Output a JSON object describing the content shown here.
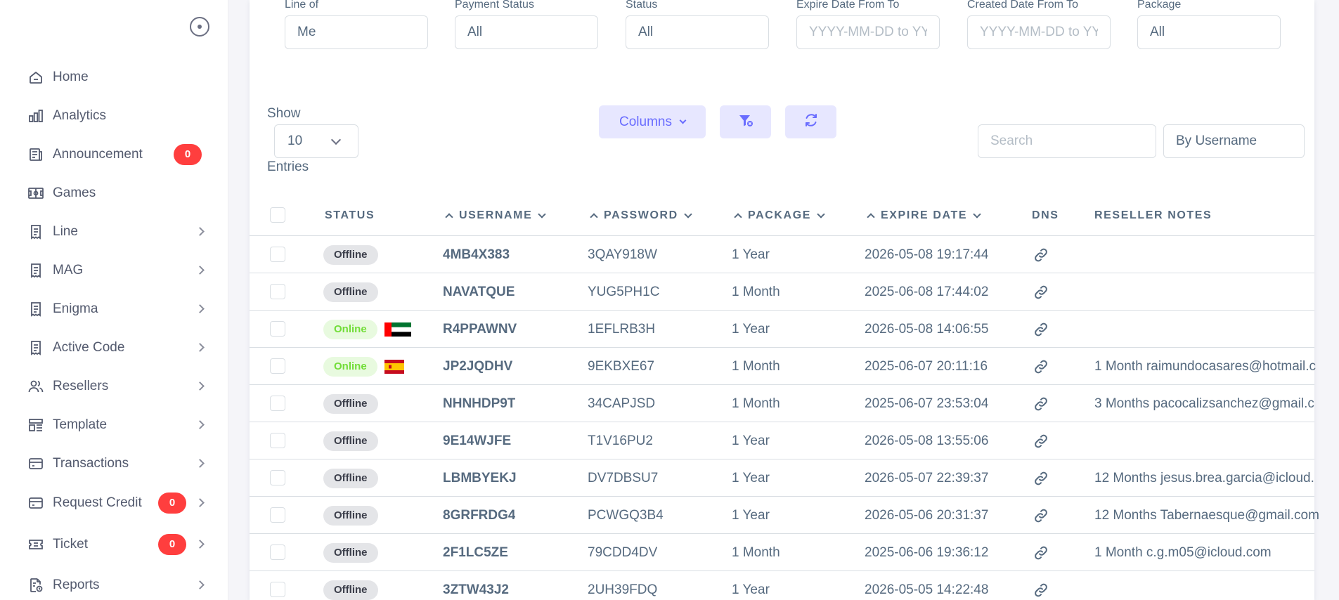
{
  "sidebar": {
    "items": [
      {
        "key": "home",
        "label": "Home",
        "icon": "home-icon",
        "badge": null,
        "chevron": false
      },
      {
        "key": "analytics",
        "label": "Analytics",
        "icon": "bar-chart-icon",
        "badge": null,
        "chevron": false
      },
      {
        "key": "announcement",
        "label": "Announcement",
        "icon": "news-icon",
        "badge": "0",
        "chevron": false
      },
      {
        "key": "games",
        "label": "Games",
        "icon": "football-field-icon",
        "badge": null,
        "chevron": false
      },
      {
        "key": "line",
        "label": "Line",
        "icon": "receipt-icon",
        "badge": null,
        "chevron": true
      },
      {
        "key": "mag",
        "label": "MAG",
        "icon": "receipt-icon",
        "badge": null,
        "chevron": true
      },
      {
        "key": "enigma",
        "label": "Enigma",
        "icon": "receipt-icon",
        "badge": null,
        "chevron": true
      },
      {
        "key": "active-code",
        "label": "Active Code",
        "icon": "receipt-icon",
        "badge": null,
        "chevron": true
      },
      {
        "key": "resellers",
        "label": "Resellers",
        "icon": "users-icon",
        "badge": null,
        "chevron": true
      },
      {
        "key": "template",
        "label": "Template",
        "icon": "template-icon",
        "badge": null,
        "chevron": true
      },
      {
        "key": "transactions",
        "label": "Transactions",
        "icon": "credit-card-icon",
        "badge": null,
        "chevron": true
      },
      {
        "key": "request-credit",
        "label": "Request Credit",
        "icon": "credit-card-icon",
        "badge": "0",
        "chevron": true
      },
      {
        "key": "ticket",
        "label": "Ticket",
        "icon": "ticket-icon",
        "badge": "0",
        "chevron": true
      },
      {
        "key": "reports",
        "label": "Reports",
        "icon": "report-icon",
        "badge": null,
        "chevron": true
      }
    ]
  },
  "filters": {
    "line_of": {
      "label": "Line of",
      "value": "Me"
    },
    "payment_status": {
      "label": "Payment Status",
      "value": "All"
    },
    "status": {
      "label": "Status",
      "value": "All"
    },
    "expire_date": {
      "label": "Expire Date From To",
      "placeholder": "YYYY-MM-DD to YYYY-MM-DD"
    },
    "created_date": {
      "label": "Created Date From To",
      "placeholder": "YYYY-MM-DD to YYYY-MM-DD"
    },
    "package": {
      "label": "Package",
      "value": "All"
    }
  },
  "toolbar": {
    "show_label": "Show",
    "show_value": "10",
    "entries_label": "Entries",
    "columns_label": "Columns",
    "search_placeholder": "Search",
    "search_by": "By Username"
  },
  "table": {
    "headers": {
      "status": "STATUS",
      "username": "USERNAME",
      "password": "PASSWORD",
      "package": "PACKAGE",
      "expire_date": "EXPIRE DATE",
      "dns": "DNS",
      "notes": "RESELLER NOTES"
    },
    "rows": [
      {
        "status": "Offline",
        "flag": "",
        "username": "4MB4X383",
        "password": "3QAY918W",
        "package": "1 Year",
        "expire": "2026-05-08 19:17:44",
        "notes": ""
      },
      {
        "status": "Offline",
        "flag": "",
        "username": "NAVATQUE",
        "password": "YUG5PH1C",
        "package": "1 Month",
        "expire": "2025-06-08 17:44:02",
        "notes": ""
      },
      {
        "status": "Online",
        "flag": "ae",
        "username": "R4PPAWNV",
        "password": "1EFLRB3H",
        "package": "1 Year",
        "expire": "2026-05-08 14:06:55",
        "notes": ""
      },
      {
        "status": "Online",
        "flag": "es",
        "username": "JP2JQDHV",
        "password": "9EKBXE67",
        "package": "1 Month",
        "expire": "2025-06-07 20:11:16",
        "notes": "1 Month raimundocasares@hotmail.c"
      },
      {
        "status": "Offline",
        "flag": "",
        "username": "NHNHDP9T",
        "password": "34CAPJSD",
        "package": "1 Month",
        "expire": "2025-06-07 23:53:04",
        "notes": "3 Months pacocalizsanchez@gmail.c"
      },
      {
        "status": "Offline",
        "flag": "",
        "username": "9E14WJFE",
        "password": "T1V16PU2",
        "package": "1 Year",
        "expire": "2026-05-08 13:55:06",
        "notes": ""
      },
      {
        "status": "Offline",
        "flag": "",
        "username": "LBMBYEKJ",
        "password": "DV7DBSU7",
        "package": "1 Year",
        "expire": "2026-05-07 22:39:37",
        "notes": "12 Months jesus.brea.garcia@icloud."
      },
      {
        "status": "Offline",
        "flag": "",
        "username": "8GRFRDG4",
        "password": "PCWGQ3B4",
        "package": "1 Year",
        "expire": "2026-05-06 20:31:37",
        "notes": "12 Months Tabernaesque@gmail.com"
      },
      {
        "status": "Offline",
        "flag": "",
        "username": "2F1LC5ZE",
        "password": "79CDD4DV",
        "package": "1 Month",
        "expire": "2025-06-06 19:36:12",
        "notes": "1 Month c.g.m05@icloud.com"
      },
      {
        "status": "Offline",
        "flag": "",
        "username": "3ZTW43J2",
        "password": "2UH39FDQ",
        "package": "1 Year",
        "expire": "2026-05-05 14:22:48",
        "notes": ""
      }
    ]
  },
  "colors": {
    "primary": "#696cff",
    "primary_light": "#e7e7ff",
    "danger": "#ff3e3e",
    "online": "#71dd37",
    "online_bg": "#e8fadf",
    "offline_bg": "#e4e5e8"
  }
}
